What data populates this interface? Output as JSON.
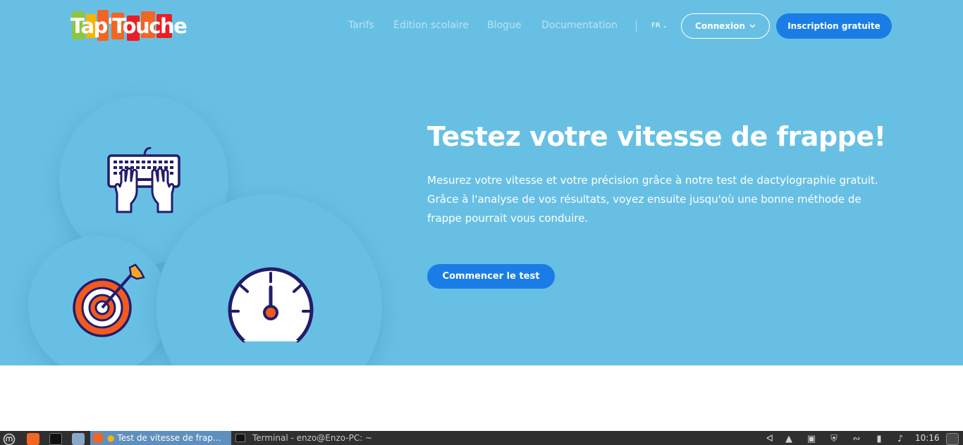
{
  "header": {
    "logo": "Tap'Touche",
    "nav": [
      "Tarifs",
      "Édition scolaire",
      "Blogue",
      "Documentation"
    ],
    "language": "FR",
    "login_label": "Connexion",
    "signup_label": "Inscription gratuite"
  },
  "hero": {
    "title": "Testez votre vitesse de frappe!",
    "description": "Mesurez votre vitesse et votre précision grâce à notre test de dactylographie gratuit. Grâce à l'analyse de vos résultats, voyez ensuite jusqu'où une bonne méthode de frappe pourrait vous conduire.",
    "cta_label": "Commencer le test"
  },
  "taskbar": {
    "active_task": "Test de vitesse de frap…",
    "terminal_task": "Terminal - enzo@Enzo-PC: ~",
    "clock": "10:16"
  },
  "colors": {
    "hero_bg": "#67c0e4",
    "primary_button": "#1a7de6",
    "icon_navy": "#231c6b",
    "icon_orange": "#f25a1f"
  }
}
